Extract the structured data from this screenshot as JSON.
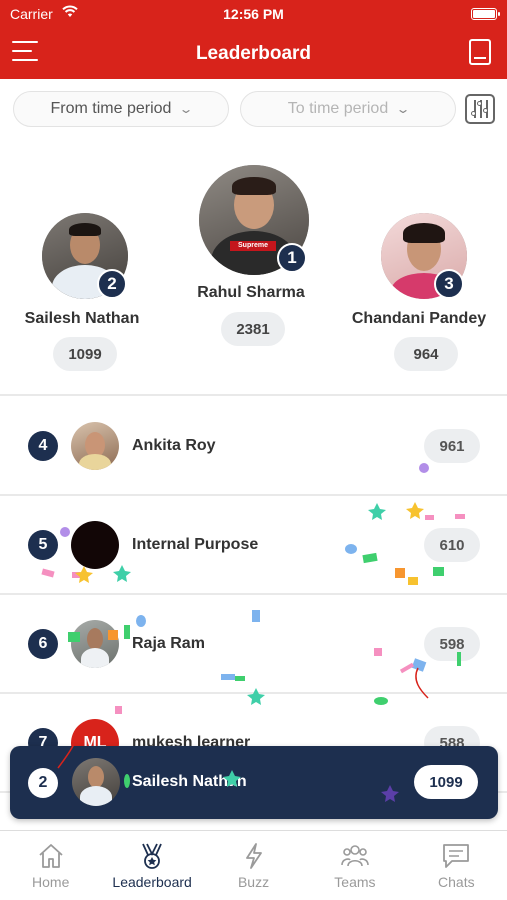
{
  "status": {
    "carrier": "Carrier",
    "time": "12:56 PM"
  },
  "header": {
    "title": "Leaderboard"
  },
  "filters": {
    "from": "From time period",
    "to": "To time period"
  },
  "podium": [
    {
      "rank": "1",
      "name": "Rahul Sharma",
      "score": "2381",
      "avatar_color": "#5b5550",
      "shirt": "#2a2a2a",
      "shirt_text": "Supreme"
    },
    {
      "rank": "2",
      "name": "Sailesh Nathan",
      "score": "1099",
      "avatar_color": "#6e6a66",
      "shirt": "#e8eef4"
    },
    {
      "rank": "3",
      "name": "Chandani  Pandey",
      "score": "964",
      "avatar_color": "#e9c7c6",
      "shirt": "#d63a6b"
    }
  ],
  "list": [
    {
      "rank": "4",
      "name": "Ankita Roy",
      "score": "961",
      "avatar_color": "#b28b6a"
    },
    {
      "rank": "5",
      "name": "Internal Purpose",
      "score": "610",
      "avatar_color": "#120606"
    },
    {
      "rank": "6",
      "name": "Raja Ram",
      "score": "598",
      "avatar_color": "#8a8f8b"
    },
    {
      "rank": "7",
      "name": "mukesh learner",
      "score": "588",
      "avatar_color": "#d8231b",
      "initials": "ML"
    }
  ],
  "me": {
    "rank": "2",
    "name": "Sailesh Nathan",
    "score": "1099"
  },
  "tabs": [
    {
      "label": "Home",
      "icon": "home-icon",
      "active": false
    },
    {
      "label": "Leaderboard",
      "icon": "trophy-icon",
      "active": true
    },
    {
      "label": "Buzz",
      "icon": "lightning-icon",
      "active": false
    },
    {
      "label": "Teams",
      "icon": "people-icon",
      "active": false
    },
    {
      "label": "Chats",
      "icon": "chat-icon",
      "active": false
    }
  ],
  "colors": {
    "primary": "#d8231b",
    "navy": "#1d2f4f",
    "pill": "#eceef0"
  }
}
